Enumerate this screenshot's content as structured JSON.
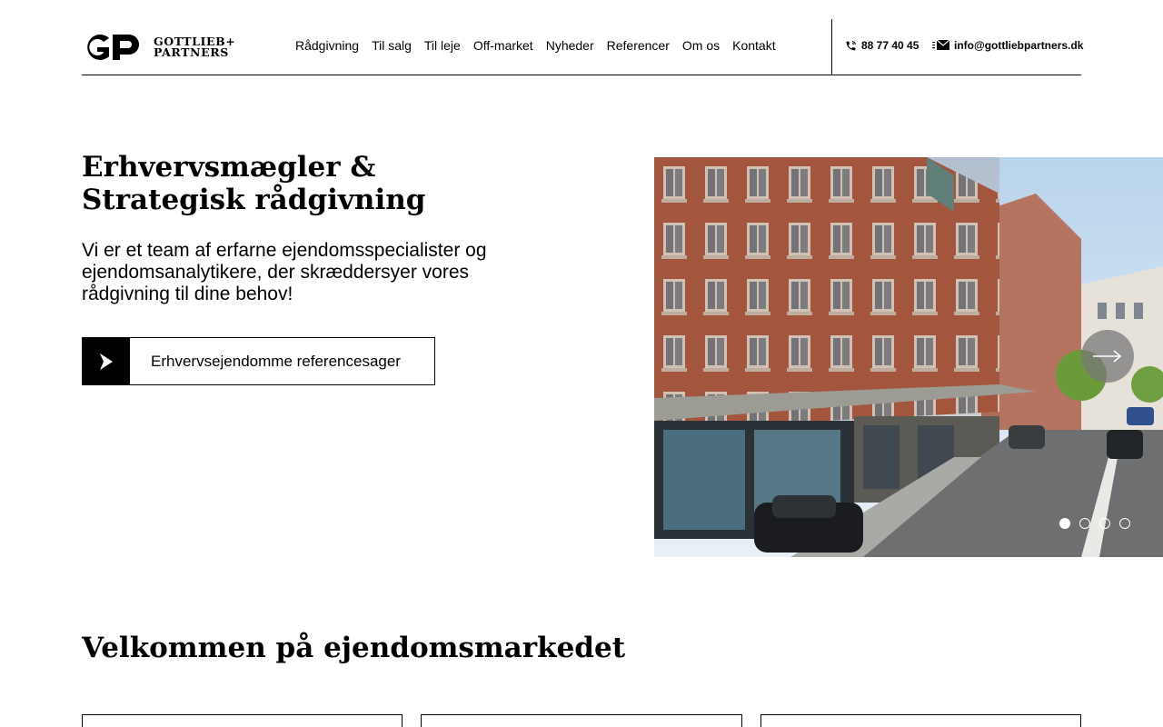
{
  "header": {
    "logo": {
      "line1": "GOTTLIEB+",
      "line2": "PARTNERS"
    },
    "nav": [
      "Rådgivning",
      "Til salg",
      "Til leje",
      "Off-market",
      "Nyheder",
      "Referencer",
      "Om os",
      "Kontakt"
    ],
    "phone": "88 77 40 45",
    "email": "info@gottliebpartners.dk"
  },
  "hero": {
    "title_line1": "Erhvervsmægler &",
    "title_line2": "Strategisk rådgivning",
    "text": "Vi er et team af erfarne ejendomsspecialister og ejendomsanalytikere, der skræddersyer vores rådgivning til dine behov!",
    "cta_label": "Erhvervsejendomme referencesager"
  },
  "slider": {
    "slide_count": 4,
    "active_slide": 1
  },
  "section": {
    "title": "Velkommen på ejendomsmarkedet"
  },
  "colors": {
    "text": "#000000",
    "background": "#ffffff",
    "brick": "#a9573f"
  }
}
